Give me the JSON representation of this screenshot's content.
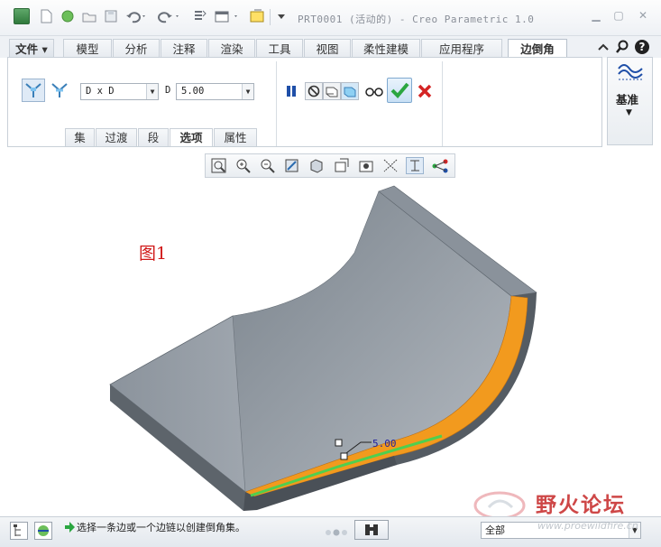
{
  "window": {
    "title": "PRT0001 (活动的) - Creo Parametric 1.0",
    "controls": [
      "minimize-icon",
      "maximize-icon",
      "close-icon"
    ]
  },
  "quick_access": [
    "app-logo-icon",
    "new-icon",
    "open-icon",
    "folder-icon",
    "save-icon",
    "undo-icon",
    "redo-icon",
    "regenerate-icon",
    "windows-icon",
    "close-window-icon",
    "customize-icon"
  ],
  "ribbon_tabs": [
    {
      "label": "文件",
      "kind": "file"
    },
    {
      "label": "模型"
    },
    {
      "label": "分析"
    },
    {
      "label": "注释"
    },
    {
      "label": "渲染"
    },
    {
      "label": "工具"
    },
    {
      "label": "视图"
    },
    {
      "label": "柔性建模"
    },
    {
      "label": "应用程序"
    },
    {
      "label": "边倒角",
      "active": true
    }
  ],
  "help_icons": [
    "collapse-ribbon-icon",
    "search-icon",
    "help-icon"
  ],
  "chamfer": {
    "set_mode_icons": [
      "set-mode-icon",
      "transition-mode-icon"
    ],
    "dimension_scheme": "D x D",
    "d_label": "D",
    "d_value": "5.00",
    "action_icons": [
      "pause-icon",
      "no-preview-icon",
      "preview-icon",
      "verify-icon",
      "ok-icon",
      "cancel-icon"
    ],
    "datum_label": "基准",
    "subtabs": [
      "集",
      "过渡",
      "段",
      "选项",
      "属性"
    ],
    "active_subtab": "选项"
  },
  "view_toolbar": [
    "refit-icon",
    "zoom-in-icon",
    "zoom-out-icon",
    "repaint-icon",
    "display-style-icon",
    "saved-views-icon",
    "view-manager-icon",
    "perspective-icon",
    "annotation-display-icon",
    "datum-display-icon",
    "spin-center-icon"
  ],
  "graphics": {
    "figure_label": "图1",
    "dimension_value": "5.00"
  },
  "status": {
    "message": "选择一条边或一个边链以创建倒角集。",
    "filter": "全部"
  },
  "watermark": {
    "text": "野火论坛",
    "url": "www.proewildfire.cn"
  },
  "colors": {
    "accent_orange": "#f29a1e",
    "selection_green": "#4fcf4f",
    "ok_green": "#2aa640",
    "cancel_red": "#d42424",
    "model_gray": "#7e8690"
  }
}
